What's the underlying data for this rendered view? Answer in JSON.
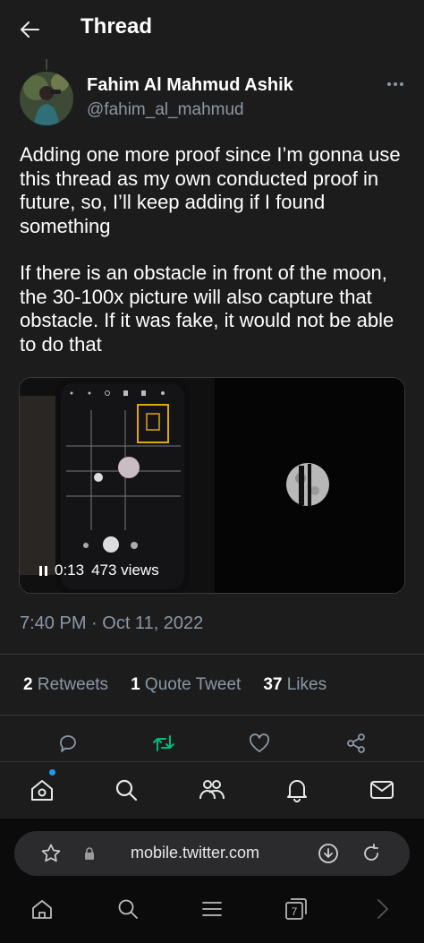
{
  "header": {
    "title": "Thread"
  },
  "author": {
    "name": "Fahim Al Mahmud Ashik",
    "handle": "@fahim_al_mahmud"
  },
  "tweet": {
    "paragraphs": [
      "Adding one more proof since I’m gonna use this thread as my own conducted proof in future, so, I’ll keep adding if I found something",
      "If there is an obstacle in front of the moon, the 30-100x picture will also capture that obstacle. If it was fake, it would not be able to do that"
    ],
    "video": {
      "time": "0:13",
      "views": "473 views"
    },
    "timestamp": "7:40 PM · Oct 11, 2022"
  },
  "stats": {
    "retweets_count": "2",
    "retweets_label": "Retweets",
    "quotes_count": "1",
    "quotes_label": "Quote Tweet",
    "likes_count": "37",
    "likes_label": "Likes"
  },
  "colors": {
    "accent": "#1d9bf0",
    "retweet_active": "#00ba7c",
    "muted": "#8b98a5"
  },
  "icons": {
    "actions": [
      "reply-icon",
      "retweet-icon",
      "like-icon",
      "share-icon"
    ],
    "tabs": [
      "home-icon",
      "search-icon",
      "communities-icon",
      "notifications-icon",
      "messages-icon"
    ],
    "browser_nav": [
      "browser-home-icon",
      "browser-search-icon",
      "browser-menu-icon",
      "tabs-icon",
      "forward-icon"
    ]
  },
  "browser": {
    "url": "mobile.twitter.com",
    "tab_count": "7"
  }
}
